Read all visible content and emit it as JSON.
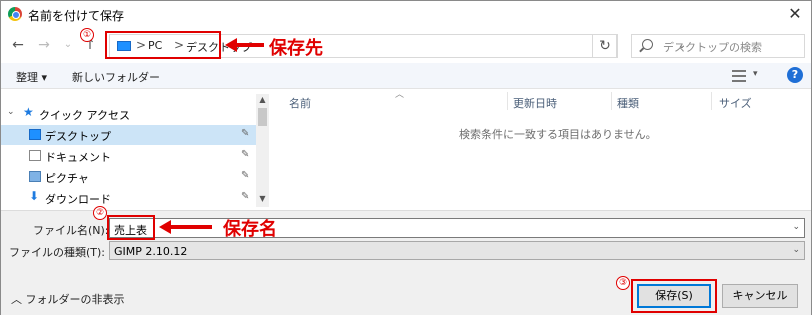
{
  "window": {
    "title": "名前を付けて保存",
    "close_glyph": "✕"
  },
  "nav": {
    "back_glyph": "←",
    "forward_glyph": "→",
    "up_glyph": "↑",
    "breadcrumbs": [
      "PC",
      "デスクトップ"
    ],
    "breadcrumb_sep": ">",
    "refresh_glyph": "↻",
    "search_placeholder": "デスクトップの検索"
  },
  "toolbar": {
    "organize": "整理 ▾",
    "new_folder": "新しいフォルダー"
  },
  "sidebar": {
    "quick_access": "クイック アクセス",
    "items": [
      {
        "label": "デスクトップ",
        "icon": "desktop-icon"
      },
      {
        "label": "ドキュメント",
        "icon": "documents-icon"
      },
      {
        "label": "ピクチャ",
        "icon": "pictures-icon"
      },
      {
        "label": "ダウンロード",
        "icon": "downloads-icon"
      }
    ],
    "pin_glyph": "📌"
  },
  "file_list": {
    "columns": [
      "名前",
      "更新日時",
      "種類",
      "サイズ"
    ],
    "empty_message": "検索条件に一致する項目はありません。"
  },
  "form": {
    "filename_label": "ファイル名(N):",
    "filename_value": "売上表",
    "filetype_label": "ファイルの種類(T):",
    "filetype_value": "GIMP 2.10.12"
  },
  "footer": {
    "hide_folders": "フォルダーの非表示",
    "save_button": "保存(S)",
    "cancel_button": "キャンセル"
  },
  "annotations": {
    "location_label": "保存先",
    "name_label": "保存名",
    "num1": "①",
    "num2": "②",
    "num3": "③",
    "color": "#e00000"
  }
}
